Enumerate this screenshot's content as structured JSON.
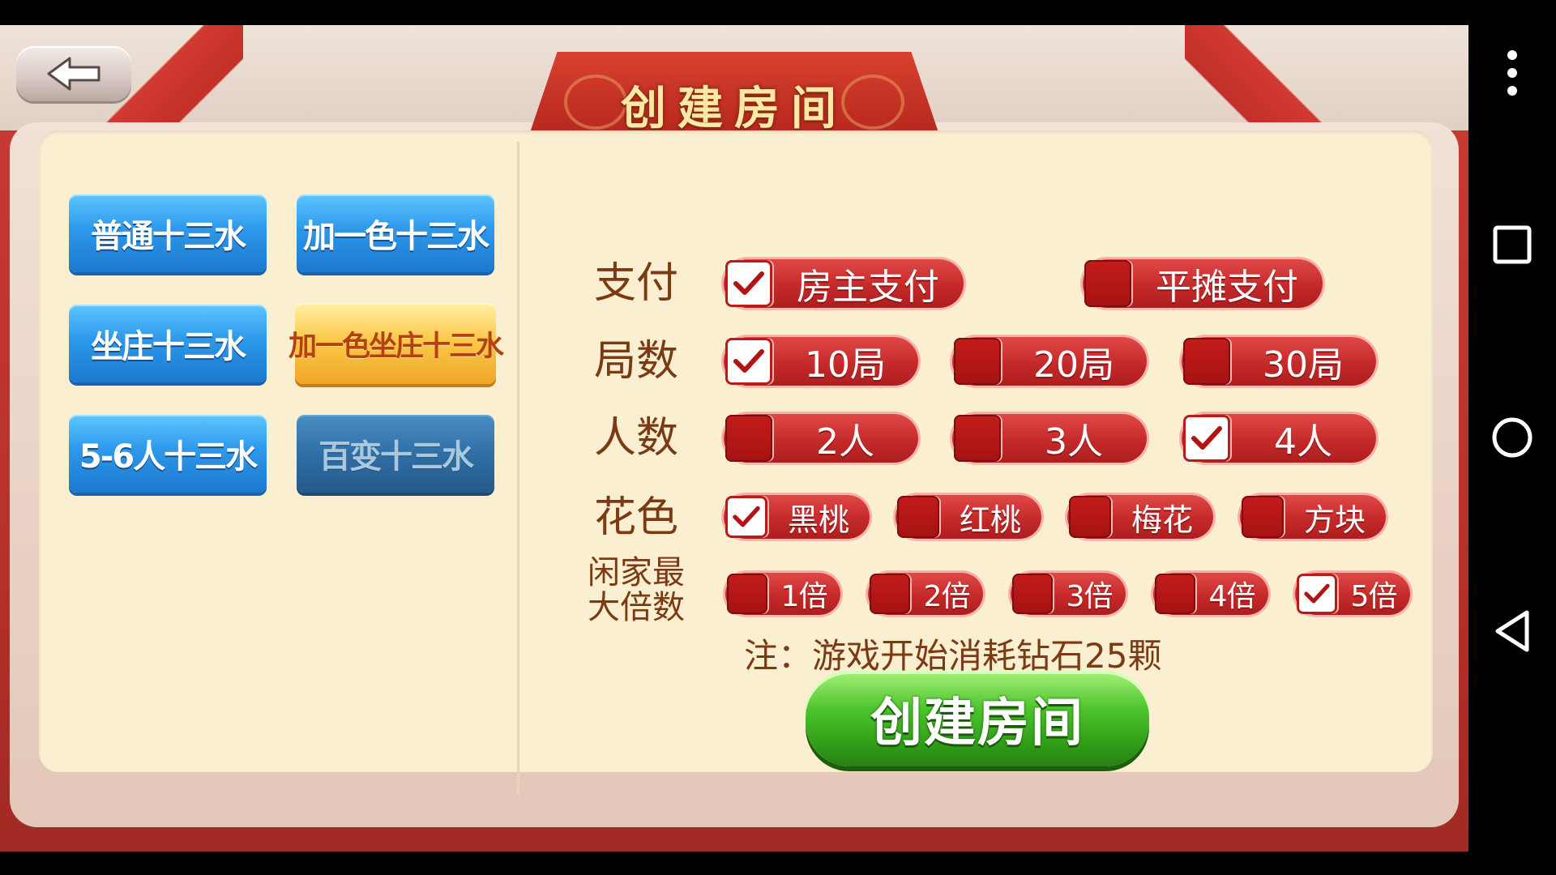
{
  "header": {
    "title": "创建房间"
  },
  "modes": [
    {
      "label": "普通十三水",
      "state": "normal"
    },
    {
      "label": "加一色十三水",
      "state": "normal"
    },
    {
      "label": "坐庄十三水",
      "state": "normal"
    },
    {
      "label": "加一色坐庄十三水",
      "state": "selected"
    },
    {
      "label": "5-6人十三水",
      "state": "normal"
    },
    {
      "label": "百变十三水",
      "state": "disabled"
    }
  ],
  "options": {
    "payment": {
      "label": "支付",
      "choices": [
        {
          "label": "房主支付",
          "checked": true
        },
        {
          "label": "平摊支付",
          "checked": false
        }
      ]
    },
    "rounds": {
      "label": "局数",
      "choices": [
        {
          "label": "10局",
          "checked": true
        },
        {
          "label": "20局",
          "checked": false
        },
        {
          "label": "30局",
          "checked": false
        }
      ]
    },
    "players": {
      "label": "人数",
      "choices": [
        {
          "label": "2人",
          "checked": false
        },
        {
          "label": "3人",
          "checked": false
        },
        {
          "label": "4人",
          "checked": true
        }
      ]
    },
    "suit": {
      "label": "花色",
      "choices": [
        {
          "label": "黑桃",
          "checked": true
        },
        {
          "label": "红桃",
          "checked": false
        },
        {
          "label": "梅花",
          "checked": false
        },
        {
          "label": "方块",
          "checked": false
        }
      ]
    },
    "multiplier": {
      "label_line1": "闲家最",
      "label_line2": "大倍数",
      "choices": [
        {
          "label": "1倍",
          "checked": false
        },
        {
          "label": "2倍",
          "checked": false
        },
        {
          "label": "3倍",
          "checked": false
        },
        {
          "label": "4倍",
          "checked": false
        },
        {
          "label": "5倍",
          "checked": true
        }
      ]
    }
  },
  "note": "注：游戏开始消耗钻石25颗",
  "create_button": {
    "label": "创建房间"
  },
  "colors": {
    "accent_red": "#c52a2a",
    "selected_gold": "#fcc94a",
    "mode_blue": "#2d98ea",
    "create_green": "#4cc52c"
  },
  "navbar": {
    "icons": [
      "more-vert-icon",
      "recent-apps-icon",
      "home-icon",
      "back-icon"
    ]
  }
}
